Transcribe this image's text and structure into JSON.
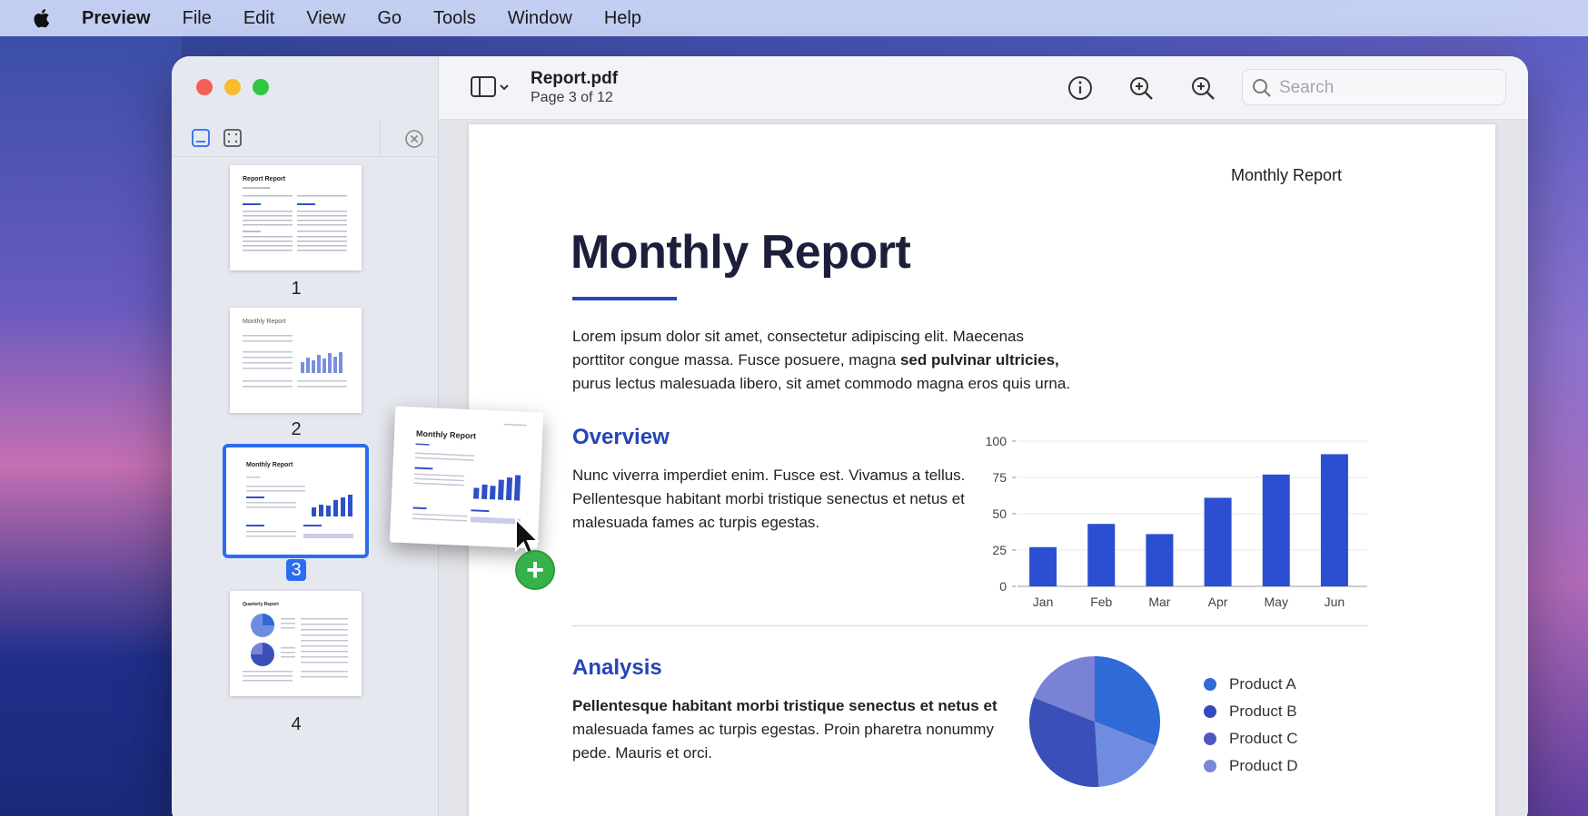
{
  "menubar": {
    "items": [
      "Preview",
      "File",
      "Edit",
      "View",
      "Go",
      "Tools",
      "Window",
      "Help"
    ]
  },
  "toolbar": {
    "title": "Report.pdf",
    "subtitle": "Page 3 of 12",
    "search_placeholder": "Search"
  },
  "sidebar": {
    "pages": [
      "1",
      "2",
      "3",
      "4"
    ],
    "selected_page": "3",
    "thumb_titles": [
      "Report Report",
      "Monthly Report",
      "Monthly Report",
      "Quarterly Report"
    ]
  },
  "drag_card": {
    "title": "Monthly Report"
  },
  "document": {
    "running_header": "Monthly Report",
    "title": "Monthly Report",
    "intro_lines": [
      "Lorem ipsum dolor sit amet, consectetur adipiscing elit. Maecenas",
      "porttitor congue massa. Fusce posuere, magna sed pulvinar ultricies,",
      "purus lectus malesuada libero, sit amet commodo magna eros quis urna."
    ],
    "overview": {
      "heading": "Overview",
      "lines": [
        "Nunc viverra imperdiet enim. Fusce est. Vivamus a tellus.",
        "Pellentesque habitant morbi tristique senectus et netus et",
        "malesuada fames ac turpis egestas."
      ]
    },
    "analysis": {
      "heading": "Analysis",
      "lines": [
        "Pellentesque habitant morbi tristique senectus et netus et",
        "malesuada fames ac turpis egestas. Proin pharetra nonummy",
        "pede. Mauris et orci."
      ]
    }
  },
  "chart_data": [
    {
      "type": "bar",
      "categories": [
        "Jan",
        "Feb",
        "Mar",
        "Apr",
        "May",
        "Jun"
      ],
      "values": [
        27,
        43,
        36,
        61,
        77,
        91
      ],
      "yticks": [
        0,
        25,
        50,
        75,
        100
      ],
      "ylim": [
        0,
        100
      ],
      "grid": true,
      "color": "#2b4fd0"
    },
    {
      "type": "pie",
      "series": [
        {
          "name": "Product A",
          "value": 31,
          "color": "#2f6ad6"
        },
        {
          "name": "Product B",
          "value": 18,
          "color": "#6f8de0"
        },
        {
          "name": "Product C",
          "value": 32,
          "color": "#3a4fb8"
        },
        {
          "name": "Product D",
          "value": 19,
          "color": "#7a82d6"
        }
      ],
      "legend_labels": [
        "Product A",
        "Product B",
        "Product C",
        "Product D"
      ],
      "legend_colors": [
        "#2f6ad6",
        "#3348c2",
        "#5058c0",
        "#7c86d8"
      ],
      "legend": "right"
    }
  ]
}
